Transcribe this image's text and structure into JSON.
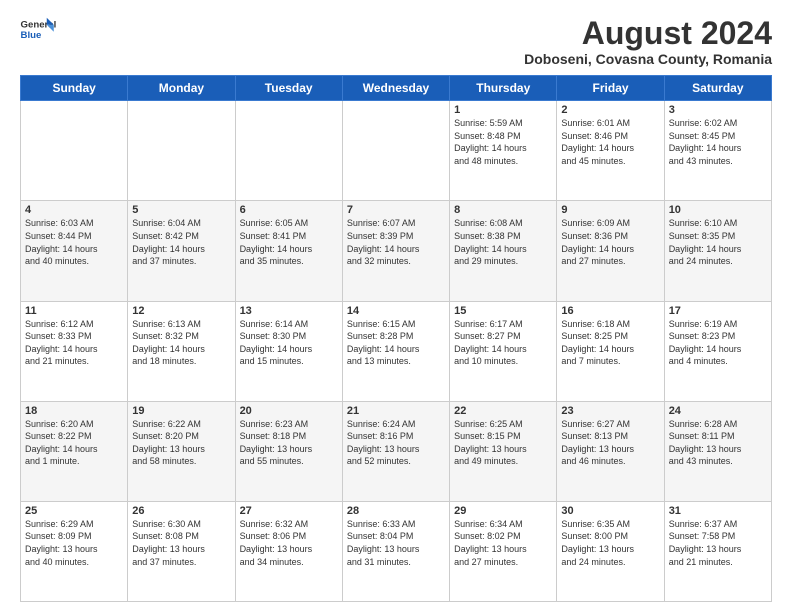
{
  "header": {
    "logo_line1": "General",
    "logo_line2": "Blue",
    "month_title": "August 2024",
    "location": "Doboseni, Covasna County, Romania"
  },
  "weekdays": [
    "Sunday",
    "Monday",
    "Tuesday",
    "Wednesday",
    "Thursday",
    "Friday",
    "Saturday"
  ],
  "weeks": [
    [
      {
        "day": "",
        "info": ""
      },
      {
        "day": "",
        "info": ""
      },
      {
        "day": "",
        "info": ""
      },
      {
        "day": "",
        "info": ""
      },
      {
        "day": "1",
        "info": "Sunrise: 5:59 AM\nSunset: 8:48 PM\nDaylight: 14 hours\nand 48 minutes."
      },
      {
        "day": "2",
        "info": "Sunrise: 6:01 AM\nSunset: 8:46 PM\nDaylight: 14 hours\nand 45 minutes."
      },
      {
        "day": "3",
        "info": "Sunrise: 6:02 AM\nSunset: 8:45 PM\nDaylight: 14 hours\nand 43 minutes."
      }
    ],
    [
      {
        "day": "4",
        "info": "Sunrise: 6:03 AM\nSunset: 8:44 PM\nDaylight: 14 hours\nand 40 minutes."
      },
      {
        "day": "5",
        "info": "Sunrise: 6:04 AM\nSunset: 8:42 PM\nDaylight: 14 hours\nand 37 minutes."
      },
      {
        "day": "6",
        "info": "Sunrise: 6:05 AM\nSunset: 8:41 PM\nDaylight: 14 hours\nand 35 minutes."
      },
      {
        "day": "7",
        "info": "Sunrise: 6:07 AM\nSunset: 8:39 PM\nDaylight: 14 hours\nand 32 minutes."
      },
      {
        "day": "8",
        "info": "Sunrise: 6:08 AM\nSunset: 8:38 PM\nDaylight: 14 hours\nand 29 minutes."
      },
      {
        "day": "9",
        "info": "Sunrise: 6:09 AM\nSunset: 8:36 PM\nDaylight: 14 hours\nand 27 minutes."
      },
      {
        "day": "10",
        "info": "Sunrise: 6:10 AM\nSunset: 8:35 PM\nDaylight: 14 hours\nand 24 minutes."
      }
    ],
    [
      {
        "day": "11",
        "info": "Sunrise: 6:12 AM\nSunset: 8:33 PM\nDaylight: 14 hours\nand 21 minutes."
      },
      {
        "day": "12",
        "info": "Sunrise: 6:13 AM\nSunset: 8:32 PM\nDaylight: 14 hours\nand 18 minutes."
      },
      {
        "day": "13",
        "info": "Sunrise: 6:14 AM\nSunset: 8:30 PM\nDaylight: 14 hours\nand 15 minutes."
      },
      {
        "day": "14",
        "info": "Sunrise: 6:15 AM\nSunset: 8:28 PM\nDaylight: 14 hours\nand 13 minutes."
      },
      {
        "day": "15",
        "info": "Sunrise: 6:17 AM\nSunset: 8:27 PM\nDaylight: 14 hours\nand 10 minutes."
      },
      {
        "day": "16",
        "info": "Sunrise: 6:18 AM\nSunset: 8:25 PM\nDaylight: 14 hours\nand 7 minutes."
      },
      {
        "day": "17",
        "info": "Sunrise: 6:19 AM\nSunset: 8:23 PM\nDaylight: 14 hours\nand 4 minutes."
      }
    ],
    [
      {
        "day": "18",
        "info": "Sunrise: 6:20 AM\nSunset: 8:22 PM\nDaylight: 14 hours\nand 1 minute."
      },
      {
        "day": "19",
        "info": "Sunrise: 6:22 AM\nSunset: 8:20 PM\nDaylight: 13 hours\nand 58 minutes."
      },
      {
        "day": "20",
        "info": "Sunrise: 6:23 AM\nSunset: 8:18 PM\nDaylight: 13 hours\nand 55 minutes."
      },
      {
        "day": "21",
        "info": "Sunrise: 6:24 AM\nSunset: 8:16 PM\nDaylight: 13 hours\nand 52 minutes."
      },
      {
        "day": "22",
        "info": "Sunrise: 6:25 AM\nSunset: 8:15 PM\nDaylight: 13 hours\nand 49 minutes."
      },
      {
        "day": "23",
        "info": "Sunrise: 6:27 AM\nSunset: 8:13 PM\nDaylight: 13 hours\nand 46 minutes."
      },
      {
        "day": "24",
        "info": "Sunrise: 6:28 AM\nSunset: 8:11 PM\nDaylight: 13 hours\nand 43 minutes."
      }
    ],
    [
      {
        "day": "25",
        "info": "Sunrise: 6:29 AM\nSunset: 8:09 PM\nDaylight: 13 hours\nand 40 minutes."
      },
      {
        "day": "26",
        "info": "Sunrise: 6:30 AM\nSunset: 8:08 PM\nDaylight: 13 hours\nand 37 minutes."
      },
      {
        "day": "27",
        "info": "Sunrise: 6:32 AM\nSunset: 8:06 PM\nDaylight: 13 hours\nand 34 minutes."
      },
      {
        "day": "28",
        "info": "Sunrise: 6:33 AM\nSunset: 8:04 PM\nDaylight: 13 hours\nand 31 minutes."
      },
      {
        "day": "29",
        "info": "Sunrise: 6:34 AM\nSunset: 8:02 PM\nDaylight: 13 hours\nand 27 minutes."
      },
      {
        "day": "30",
        "info": "Sunrise: 6:35 AM\nSunset: 8:00 PM\nDaylight: 13 hours\nand 24 minutes."
      },
      {
        "day": "31",
        "info": "Sunrise: 6:37 AM\nSunset: 7:58 PM\nDaylight: 13 hours\nand 21 minutes."
      }
    ]
  ]
}
